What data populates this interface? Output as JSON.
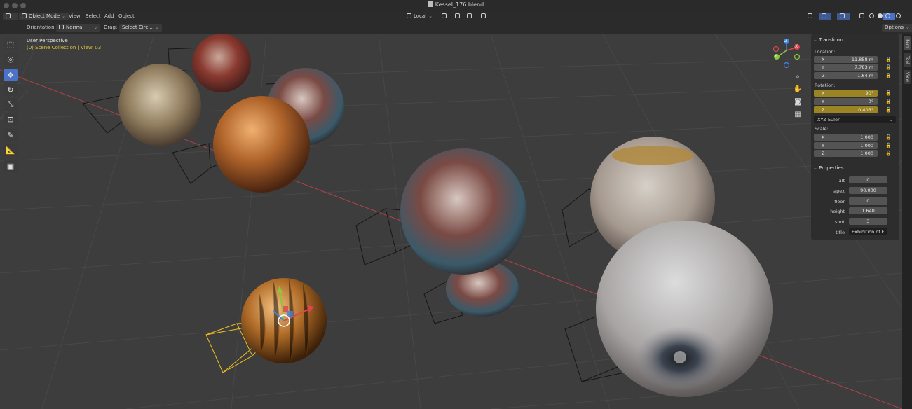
{
  "window": {
    "title": "Kessel_176.blend"
  },
  "header": {
    "mode": "Object Mode",
    "menus": [
      "View",
      "Select",
      "Add",
      "Object"
    ],
    "pivot": "Local"
  },
  "tool_settings": {
    "orientation_label": "Orientation:",
    "orientation_value": "Normal",
    "drag_label": "Drag:",
    "drag_value": "Select Circ...",
    "options": "Options"
  },
  "viewport": {
    "view_name": "User Perspective",
    "collection": "(0) Scene Collection | View_03",
    "gizmo_axes": [
      "X",
      "Y",
      "Z"
    ],
    "colors": {
      "x_axis": "#e0444f",
      "y_axis": "#8bc63f",
      "z_axis": "#3f86e0",
      "selected": "#f0c020"
    }
  },
  "toolbar": {
    "tools": [
      "select-box-icon",
      "cursor-icon",
      "move-icon",
      "rotate-icon",
      "scale-icon",
      "transform-icon",
      "annotate-icon",
      "measure-icon",
      "add-cube-icon"
    ]
  },
  "sidebar": {
    "tabs": [
      "Item",
      "Tool",
      "View"
    ],
    "transform": {
      "header": "Transform",
      "location_label": "Location:",
      "location": [
        {
          "axis": "X",
          "value": "11.858 m"
        },
        {
          "axis": "Y",
          "value": "7.783 m"
        },
        {
          "axis": "Z",
          "value": "1.64 m"
        }
      ],
      "rotation_label": "Rotation:",
      "rotation": [
        {
          "axis": "X",
          "value": "90°"
        },
        {
          "axis": "Y",
          "value": "0°"
        },
        {
          "axis": "Z",
          "value": "0.405°"
        }
      ],
      "rotation_mode": "XYZ Euler",
      "scale_label": "Scale:",
      "scale": [
        {
          "axis": "X",
          "value": "1.000"
        },
        {
          "axis": "Y",
          "value": "1.000"
        },
        {
          "axis": "Z",
          "value": "1.000"
        }
      ]
    },
    "properties": {
      "header": "Properties",
      "rows": [
        {
          "label": "alt",
          "value": "0"
        },
        {
          "label": "apex",
          "value": "90.000"
        },
        {
          "label": "floor",
          "value": "0"
        },
        {
          "label": "height",
          "value": "1.640"
        },
        {
          "label": "shot",
          "value": "3"
        },
        {
          "label": "title",
          "value": "Exhibition of F..."
        }
      ]
    }
  }
}
